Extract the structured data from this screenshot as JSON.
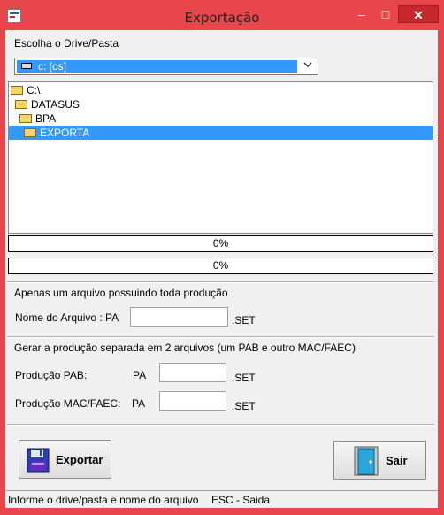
{
  "window": {
    "title": "Exportação",
    "icon_name": "app-icon",
    "controls": {
      "minimize": "–",
      "maximize": "□",
      "close": "✕"
    },
    "accent_color": "#e8464a"
  },
  "drive": {
    "label": "Escolha o Drive/Pasta",
    "selected": "c: [os]",
    "icon": "drive-icon"
  },
  "tree": {
    "items": [
      {
        "label": "C:\\",
        "icon": "open-folder-icon",
        "selected": false
      },
      {
        "label": "DATASUS",
        "icon": "open-folder-icon",
        "selected": false
      },
      {
        "label": "BPA",
        "icon": "open-folder-icon",
        "selected": false
      },
      {
        "label": "EXPORTA",
        "icon": "open-folder-icon",
        "selected": true
      }
    ]
  },
  "progress": [
    {
      "text": "0%",
      "value": 0
    },
    {
      "text": "0%",
      "value": 0
    }
  ],
  "single_file": {
    "heading": "Apenas um arquivo possuindo toda produção",
    "name_label": "Nome do Arquivo : PA",
    "value": "",
    "ext": ".SET"
  },
  "split_files": {
    "heading": "Gerar a produção separada em 2 arquivos (um PAB e outro MAC/FAEC)",
    "pab_label": "Produção PAB:",
    "pab_prefix": "PA",
    "pab_value": "",
    "pab_ext": ".SET",
    "mac_label": "Produção MAC/FAEC:",
    "mac_prefix": "PA",
    "mac_value": "",
    "mac_ext": ".SET"
  },
  "buttons": {
    "export_label": "Exportar",
    "export_icon": "floppy-disk-icon",
    "exit_label": "Sair",
    "exit_icon": "door-icon"
  },
  "status": {
    "hint": "Informe o drive/pasta e nome do arquivo",
    "shortcut": "ESC - Saida"
  }
}
